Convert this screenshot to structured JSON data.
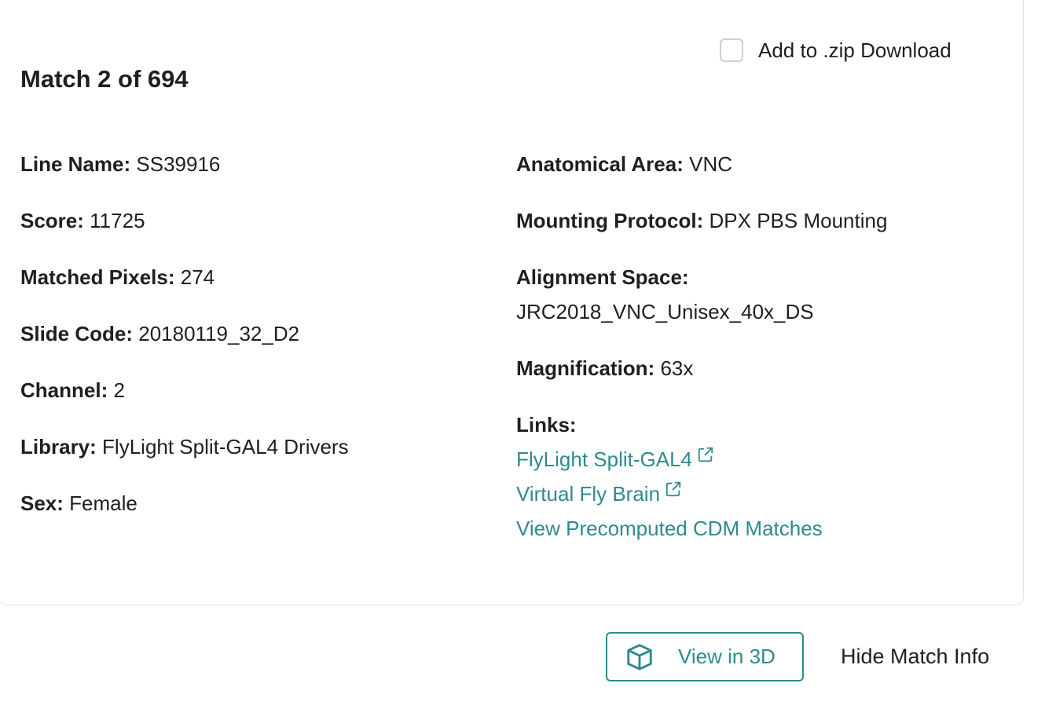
{
  "header": {
    "title": "Match 2 of 694",
    "zip_label": "Add to .zip Download",
    "zip_checked": false
  },
  "details_left": [
    {
      "key": "Line Name:",
      "value": "SS39916"
    },
    {
      "key": "Score:",
      "value": "11725"
    },
    {
      "key": "Matched Pixels:",
      "value": "274"
    },
    {
      "key": "Slide Code:",
      "value": "20180119_32_D2"
    },
    {
      "key": "Channel:",
      "value": "2"
    },
    {
      "key": "Library:",
      "value": "FlyLight Split-GAL4 Drivers"
    },
    {
      "key": "Sex:",
      "value": "Female"
    }
  ],
  "details_right": {
    "anatomical_area": {
      "key": "Anatomical Area:",
      "value": "VNC"
    },
    "mounting_protocol": {
      "key": "Mounting Protocol:",
      "value": "DPX PBS Mounting"
    },
    "alignment_space": {
      "key": "Alignment Space:",
      "value": "JRC2018_VNC_Unisex_40x_DS"
    },
    "magnification": {
      "key": "Magnification:",
      "value": "63x"
    },
    "links_label": "Links:"
  },
  "links": [
    {
      "label": "FlyLight Split-GAL4",
      "icon": "external-link-icon"
    },
    {
      "label": "Virtual Fly Brain",
      "icon": "external-link-icon"
    },
    {
      "label": "View Precomputed CDM Matches",
      "icon": ""
    }
  ],
  "footer": {
    "view3d_label": "View in 3D",
    "view3d_icon": "cube-icon",
    "hide_label": "Hide Match Info"
  },
  "colors": {
    "accent": "#2e8a8c",
    "text": "#1f1f1f",
    "border": "#e3e3e3"
  }
}
